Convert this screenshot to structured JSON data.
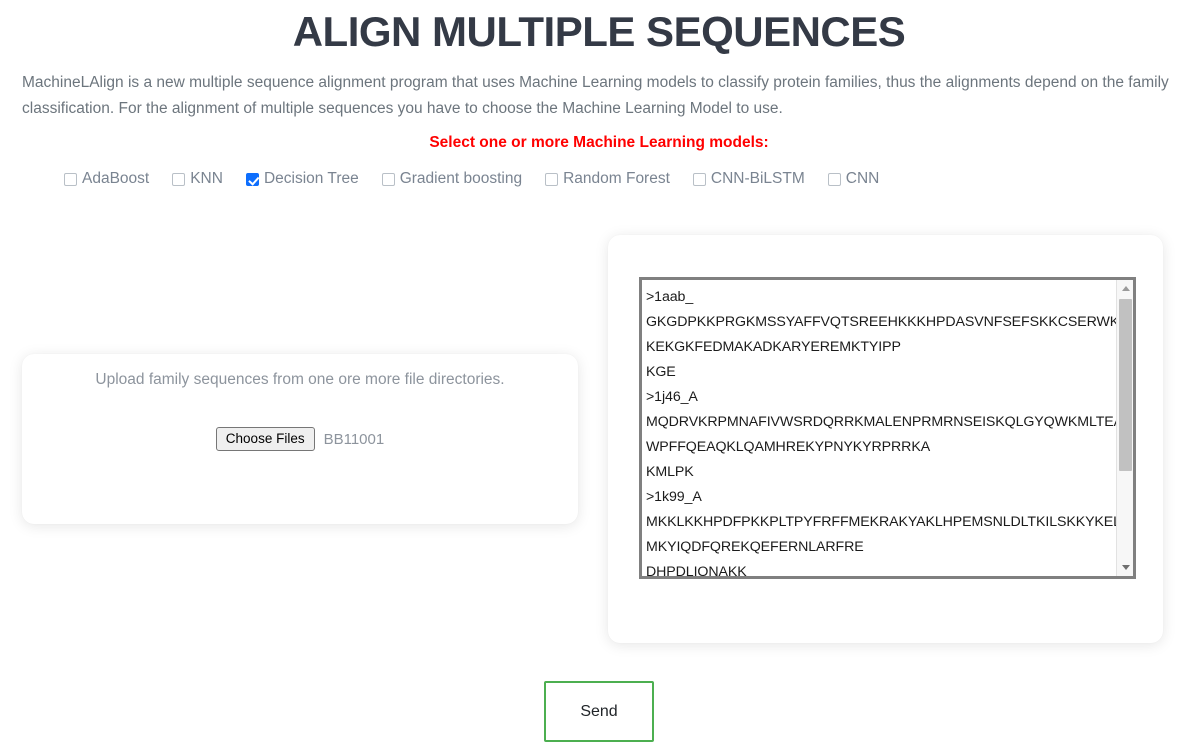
{
  "header": {
    "title": "ALIGN MULTIPLE SEQUENCES",
    "intro": "MachineLAlign is a new multiple sequence alignment program that uses Machine Learning models to classify protein families, thus the alignments depend on the family classification. For the alignment of multiple sequences you have to choose the Machine Learning Model to use.",
    "select_note": "Select one or more Machine Learning models:"
  },
  "models": [
    {
      "label": "AdaBoost",
      "checked": false
    },
    {
      "label": "KNN",
      "checked": false
    },
    {
      "label": "Decision Tree",
      "checked": true
    },
    {
      "label": "Gradient boosting",
      "checked": false
    },
    {
      "label": "Random Forest",
      "checked": false
    },
    {
      "label": "CNN-BiLSTM",
      "checked": false
    },
    {
      "label": "CNN",
      "checked": false
    }
  ],
  "upload": {
    "prompt": "Upload family sequences from one ore more file directories.",
    "button_label": "Choose Files",
    "file_name": "BB11001"
  },
  "sequences": {
    "text": ">1aab_\nGKGDPKKPRGKMSSYAFFVQTSREEHKKKHPDASVNFSEFSKKCSERWKTMSA\nKEKGKFEDMAKADKARYEREMKTYIPP\nKGE\n>1j46_A\nMQDRVKRPMNAFIVWSRDQRRKMALENPRMRNSEISKQLGYQWKMLTEAEK\nWPFFQEAQKLQAMHREKYPNYKYRPRRKA\nKMLPK\n>1k99_A\nMKKLKKHPDFPKKPLTPYFRFFMEKRAKYAKLHPEMSNLDLTKILSKKYKELPEKKK\nMKYIQDFQREKQEFERNLARFRE\nDHPDLIQNAKK"
  },
  "actions": {
    "send_label": "Send"
  },
  "colors": {
    "title": "#343a46",
    "note": "#ff0000",
    "checkbox_checked": "#0d6efd",
    "send_border": "#4caf50",
    "textarea_border": "#808080"
  }
}
